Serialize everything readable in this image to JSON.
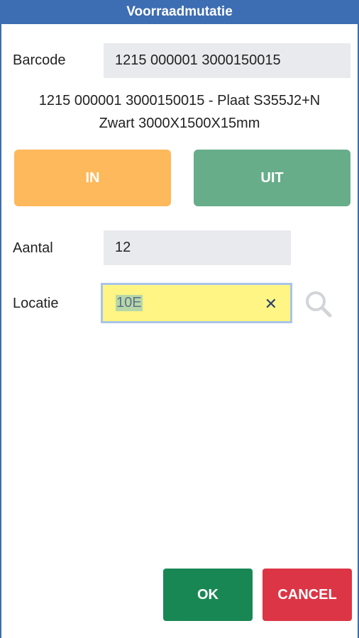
{
  "title": "Voorraadmutatie",
  "barcode": {
    "label": "Barcode",
    "value": "1215 000001 3000150015"
  },
  "description": {
    "line1": "1215 000001 3000150015 - Plaat S355J2+N",
    "line2": "Zwart 3000X1500X15mm"
  },
  "direction": {
    "in_label": "IN",
    "out_label": "UIT"
  },
  "quantity": {
    "label": "Aantal",
    "value": "12"
  },
  "location": {
    "label": "Locatie",
    "value": "10E",
    "clear_glyph": "✕"
  },
  "footer": {
    "ok_label": "OK",
    "cancel_label": "CANCEL"
  },
  "colors": {
    "titlebar": "#3d6db3",
    "in_button": "#fdb95b",
    "out_button": "#67ad8a",
    "ok_button": "#198754",
    "cancel_button": "#dc3545",
    "location_highlight": "#fff584"
  },
  "icons": {
    "search": "search-icon",
    "clear": "close-icon"
  }
}
